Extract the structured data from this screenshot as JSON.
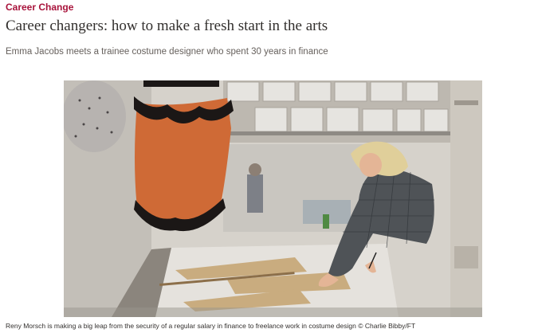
{
  "article": {
    "kicker": "Career Change",
    "headline": "Career changers: how to make a fresh start in the arts",
    "standfirst": "Emma Jacobs meets a trainee costume designer who spent 30 years in finance"
  },
  "photo": {
    "caption": "Reny Morsch is making a big leap from the security of a regular salary in finance to freelance work in costume design © Charlie Bibby/FT"
  },
  "colors": {
    "kicker": "#a8133b",
    "headline": "#33302e",
    "standfirst": "#66605c"
  }
}
